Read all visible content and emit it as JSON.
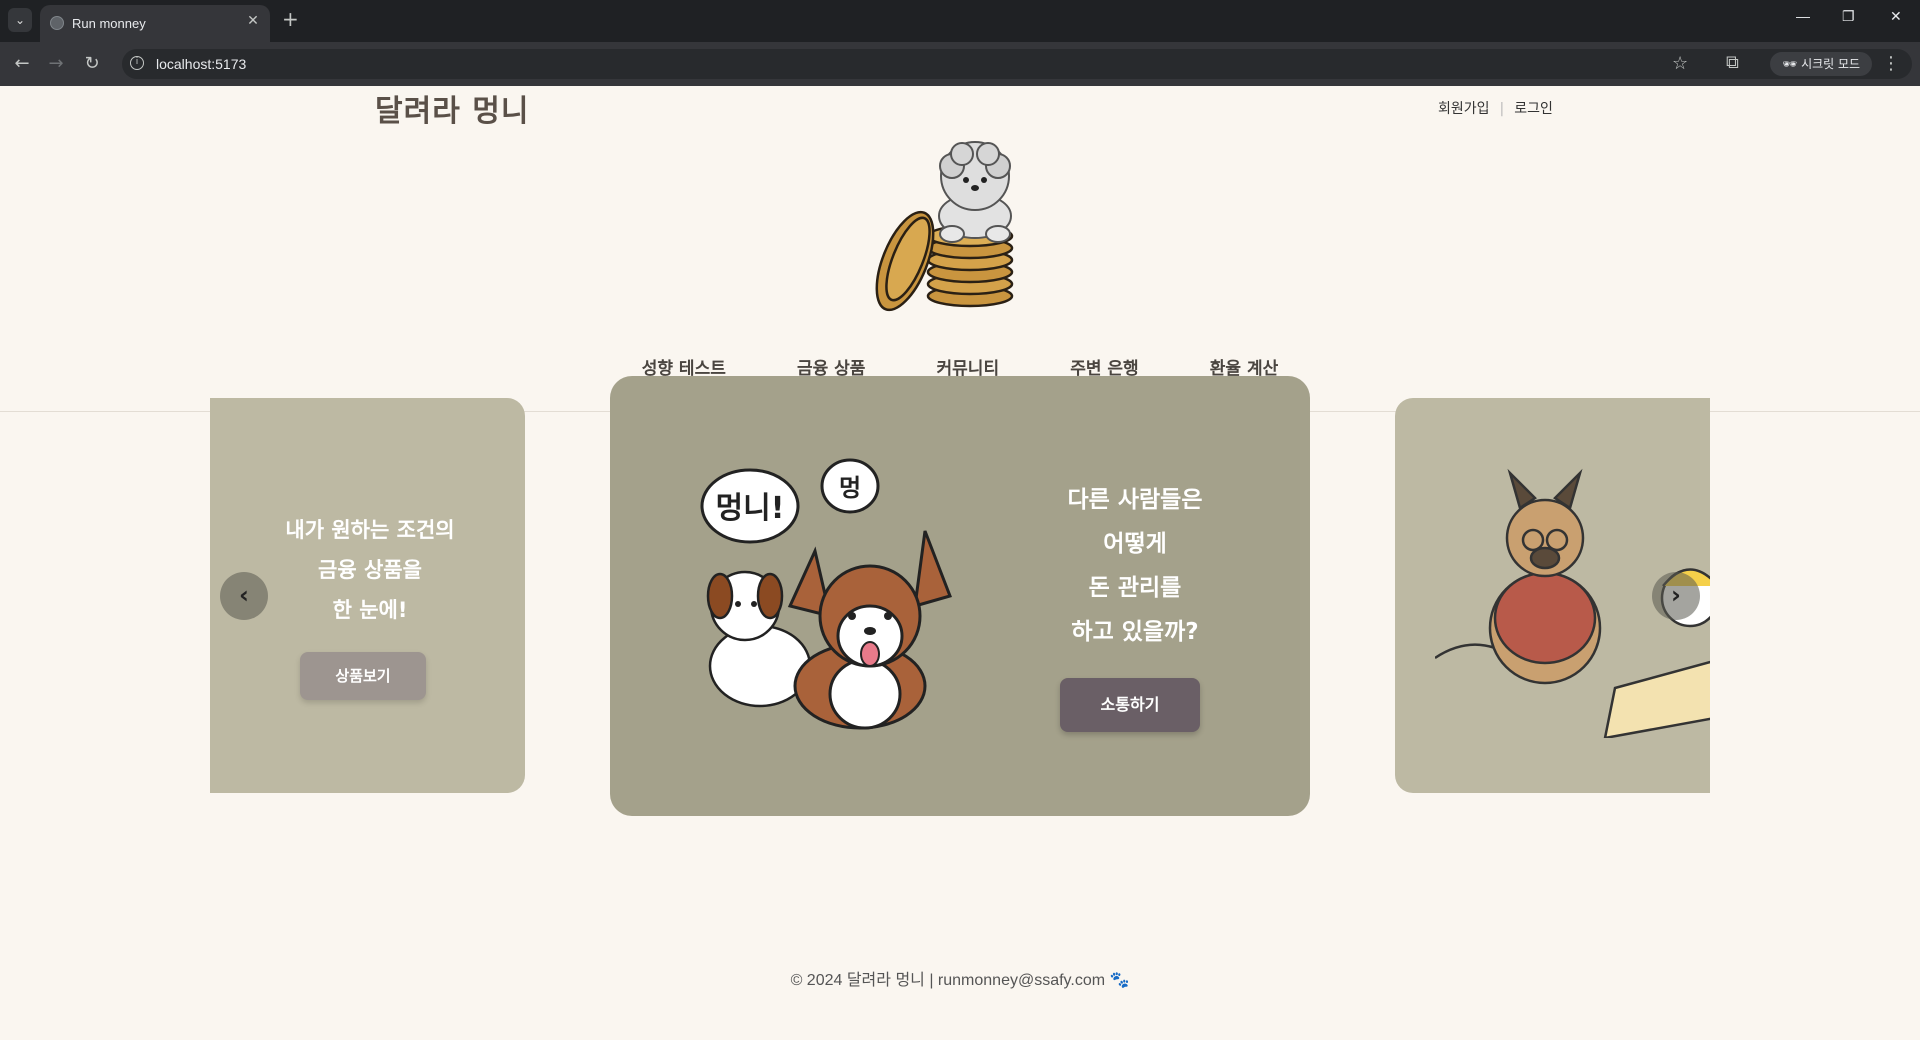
{
  "browser": {
    "tab_title": "Run monney",
    "tab_close": "✕",
    "new_tab": "+",
    "url": "localhost:5173",
    "incognito_label": "시크릿 모드",
    "minimize": "—",
    "restore": "❐",
    "close": "✕",
    "back": "←",
    "forward": "→",
    "reload": "↻",
    "star": "☆",
    "extensions": "⧉",
    "menu": "⋮",
    "tab_list": "⌄"
  },
  "header": {
    "logo": "달려라 멍니",
    "signup": "회원가입",
    "login": "로그인",
    "separator": "|"
  },
  "nav": {
    "items": [
      "성향 테스트",
      "금융 상품",
      "커뮤니티",
      "주변 은행",
      "환율 계산"
    ]
  },
  "carousel": {
    "left": {
      "line1": "내가 원하는 조건의",
      "line2": "금융 상품을",
      "line3": "한 눈에!",
      "button": "상품보기"
    },
    "center": {
      "bubble1": "멍니!",
      "bubble2": "멍",
      "line1": "다른 사람들은",
      "line2": "어떻게",
      "line3": "돈 관리를",
      "line4": "하고 있을까?",
      "button": "소통하기"
    },
    "prev": "‹",
    "next": "›"
  },
  "footer": {
    "text": "© 2024 달려라 멍니 | runmonney@ssafy.com"
  },
  "colors": {
    "page_bg": "#faf6f0",
    "card_side": "#bdb9a3",
    "card_center": "#a4a18b",
    "button_center": "#6a5f66",
    "button_left": "#9d9590"
  }
}
